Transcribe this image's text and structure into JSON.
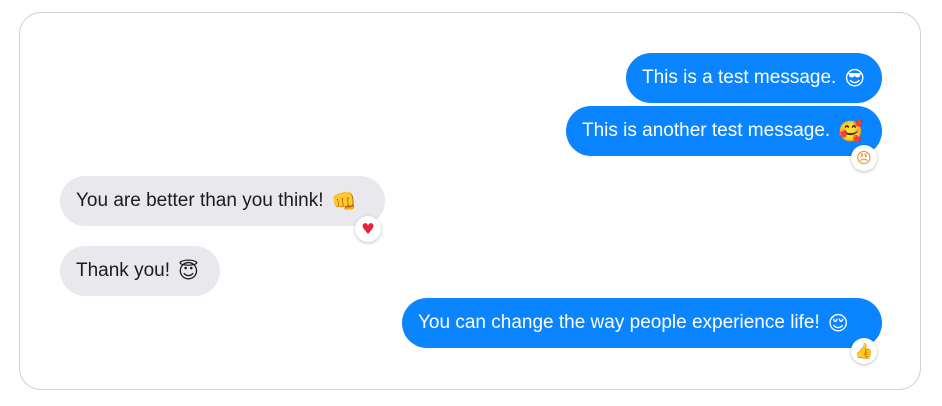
{
  "chat": {
    "messages": [
      {
        "direction": "outgoing",
        "text": "This is a test message.",
        "emoji": "😎"
      },
      {
        "direction": "outgoing",
        "text": "This is another test message.",
        "emoji": "🥰",
        "reaction": "😠"
      },
      {
        "direction": "incoming",
        "text": "You are better than you think!",
        "emoji": "👊",
        "reaction": "♥"
      },
      {
        "direction": "incoming",
        "text": "Thank you!",
        "emoji": "😇"
      },
      {
        "direction": "outgoing",
        "text": "You can change the way people experience life!",
        "emoji": "😌",
        "reaction": "👍"
      }
    ]
  },
  "colors": {
    "outgoing_bubble": "#0a84ff",
    "incoming_bubble": "#e8e8ed",
    "frame_border": "#cfcfd4"
  }
}
